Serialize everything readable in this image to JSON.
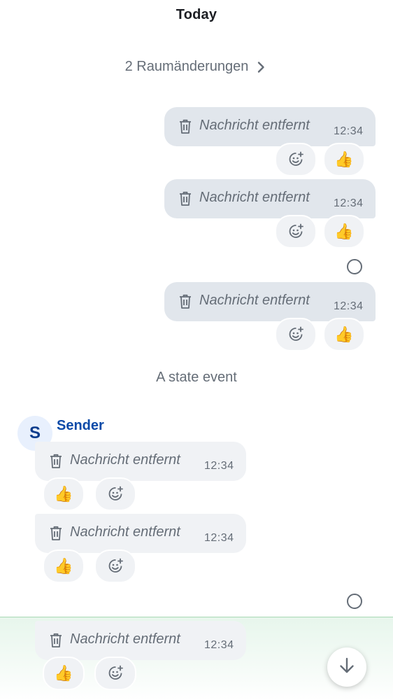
{
  "timeline": {
    "date_header": "Today",
    "room_changes": "2 Raumänderungen",
    "state_event": "A state event",
    "sender": {
      "initial": "S",
      "name": "Sender"
    },
    "removed_text": "Nachricht entfernt",
    "time": "12:34",
    "reaction_emoji": "👍",
    "icons": {
      "chevron": "chevron-right-icon",
      "trash": "trash-icon",
      "add_reaction": "add-reaction-icon",
      "read_receipt": "read-receipt-icon",
      "scroll_down": "arrow-down-icon"
    }
  },
  "messages": [
    {
      "text": "Nachricht entfernt",
      "time": "12:34",
      "reaction": "👍"
    },
    {
      "text": "Nachricht entfernt",
      "time": "12:34",
      "reaction": "👍"
    },
    {
      "text": "Nachricht entfernt",
      "time": "12:34",
      "reaction": "👍"
    },
    {
      "text": "Nachricht entfernt",
      "time": "12:34",
      "reaction": "👍"
    },
    {
      "text": "Nachricht entfernt",
      "time": "12:34",
      "reaction": "👍"
    },
    {
      "text": "Nachricht entfernt",
      "time": "12:34",
      "reaction": "👍"
    }
  ],
  "colors": {
    "outgoing_bubble": "#e1e6ec",
    "incoming_bubble": "#f0f2f5",
    "secondary_text": "#656d77",
    "sender_name": "#0b4aa8",
    "new_messages_highlight": "#e7f6ec"
  }
}
